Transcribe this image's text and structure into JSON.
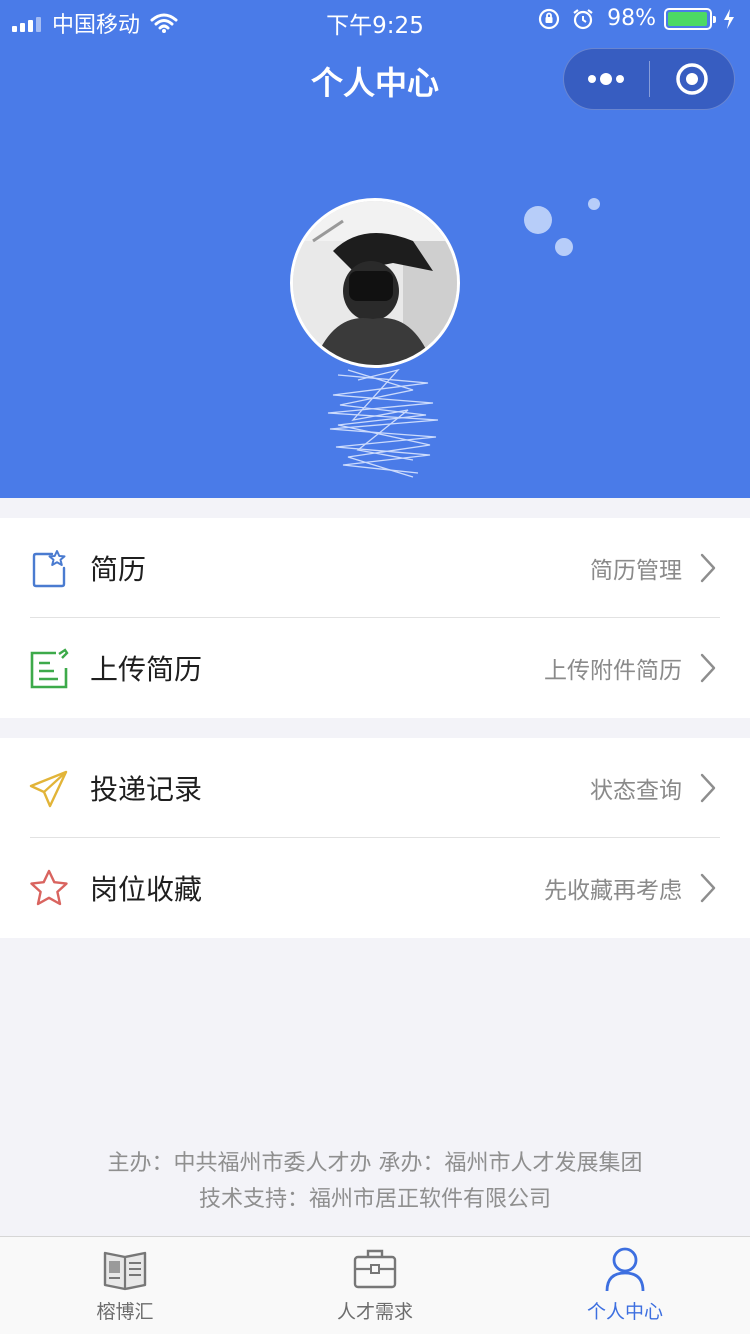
{
  "status_bar": {
    "carrier": "中国移动",
    "time": "下午9:25",
    "battery": "98%",
    "battery_level": 0.98
  },
  "nav": {
    "title": "个人中心",
    "more_icon": "more-dots-icon",
    "close_icon": "target-circle-icon"
  },
  "profile": {
    "avatar_icon": "user-avatar-photo"
  },
  "menu_group_1": [
    {
      "title": "简历",
      "subtitle": "简历管理",
      "icon": "resume-star-icon",
      "color": "#4a7bd0"
    },
    {
      "title": "上传简历",
      "subtitle": "上传附件简历",
      "icon": "upload-edit-icon",
      "color": "#3daa4a"
    }
  ],
  "menu_group_2": [
    {
      "title": "投递记录",
      "subtitle": "状态查询",
      "icon": "paper-plane-icon",
      "color": "#e2b438"
    },
    {
      "title": "岗位收藏",
      "subtitle": "先收藏再考虑",
      "icon": "star-outline-icon",
      "color": "#d9645f"
    }
  ],
  "footer": {
    "line1": "主办：中共福州市委人才办 承办：福州市人才发展集团",
    "line2": "技术支持：福州市居正软件有限公司"
  },
  "tabs": [
    {
      "label": "榕博汇",
      "icon": "book-icon",
      "active": false
    },
    {
      "label": "人才需求",
      "icon": "briefcase-icon",
      "active": false
    },
    {
      "label": "个人中心",
      "icon": "person-icon",
      "active": true
    }
  ],
  "colors": {
    "header_bg": "#4a7be8",
    "accent": "#3d6fe0",
    "page_bg": "#f3f3f8"
  }
}
